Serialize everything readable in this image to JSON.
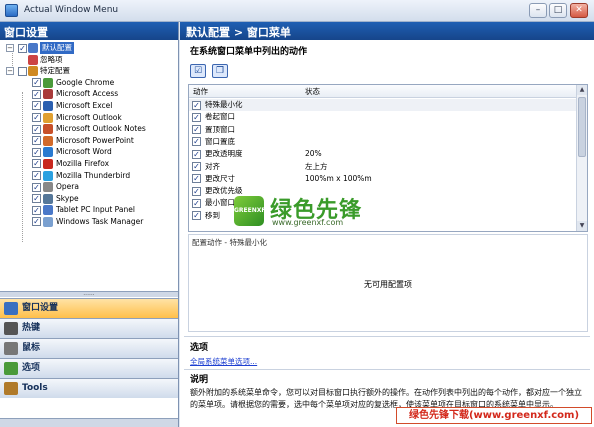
{
  "window": {
    "title": "Actual Window Menu",
    "minimize": "–",
    "maximize": "□",
    "close": "✕"
  },
  "left_pane": {
    "header": "窗口设置",
    "tree": [
      {
        "label": "默认配置",
        "level": 1,
        "selected": true,
        "checked": true
      },
      {
        "label": "忽略项",
        "level": 2,
        "checked": false
      },
      {
        "label": "特定配置",
        "level": 1,
        "checked": false
      },
      {
        "label": "Google Chrome",
        "level": 3,
        "checked": true
      },
      {
        "label": "Microsoft Access",
        "level": 3,
        "checked": true
      },
      {
        "label": "Microsoft Excel",
        "level": 3,
        "checked": true
      },
      {
        "label": "Microsoft Outlook",
        "level": 3,
        "checked": true
      },
      {
        "label": "Microsoft Outlook Notes",
        "level": 3,
        "checked": true
      },
      {
        "label": "Microsoft PowerPoint",
        "level": 3,
        "checked": true
      },
      {
        "label": "Microsoft Word",
        "level": 3,
        "checked": true
      },
      {
        "label": "Mozilla Firefox",
        "level": 3,
        "checked": true
      },
      {
        "label": "Mozilla Thunderbird",
        "level": 3,
        "checked": true
      },
      {
        "label": "Opera",
        "level": 3,
        "checked": true
      },
      {
        "label": "Skype",
        "level": 3,
        "checked": true
      },
      {
        "label": "Tablet PC Input Panel",
        "level": 3,
        "checked": true
      },
      {
        "label": "Windows Task Manager",
        "level": 3,
        "checked": true
      }
    ],
    "nav": [
      {
        "label": "窗口设置",
        "active": true
      },
      {
        "label": "热键",
        "active": false
      },
      {
        "label": "鼠标",
        "active": false
      },
      {
        "label": "选项",
        "active": false
      },
      {
        "label": "Tools",
        "active": false
      }
    ]
  },
  "right_pane": {
    "header": "默认配置 > 窗口菜单",
    "section_title": "在系统窗口菜单中列出的动作",
    "columns": [
      "动作",
      "状态"
    ],
    "actions": [
      {
        "name": "特殊最小化",
        "status": "",
        "checked": true
      },
      {
        "name": "卷起窗口",
        "status": "",
        "checked": true
      },
      {
        "name": "置顶窗口",
        "status": "",
        "checked": true
      },
      {
        "name": "窗口置底",
        "status": "",
        "checked": true
      },
      {
        "name": "更改透明度",
        "status": "20%",
        "checked": true
      },
      {
        "name": "对齐",
        "status": "左上方",
        "checked": true
      },
      {
        "name": "更改尺寸",
        "status": "100%m x 100%m",
        "checked": true
      },
      {
        "name": "更改优先级",
        "status": "",
        "checked": true
      },
      {
        "name": "最小窗口",
        "status": "",
        "checked": true
      },
      {
        "name": "移到",
        "status": "",
        "checked": true
      }
    ],
    "config_label": "配置动作 - 特殊最小化",
    "no_config": "无可用配置项",
    "options_title": "选项",
    "options_link": "全局系统菜单选项...",
    "desc_title": "说明",
    "desc_text": "额外附加的系统菜单命令，您可以对目标窗口执行额外的操作。在动作列表中列出的每个动作，都对应一个独立的菜单项。请根据您的需要，选中每个菜单项对应的复选框，使该菜单项在目标窗口的系统菜单中显示。"
  },
  "watermark": {
    "logo_text": "GREENXF",
    "title": "绿色先锋",
    "url": "www.greenxf.com",
    "badge": "绿色先锋下载(www.greenxf.com)"
  },
  "colors": {
    "header_blue": "#1e5fb3",
    "selected_blue": "#316ac5",
    "nav_active": "#ffbf4a",
    "watermark_green": "#3a9b2a"
  }
}
